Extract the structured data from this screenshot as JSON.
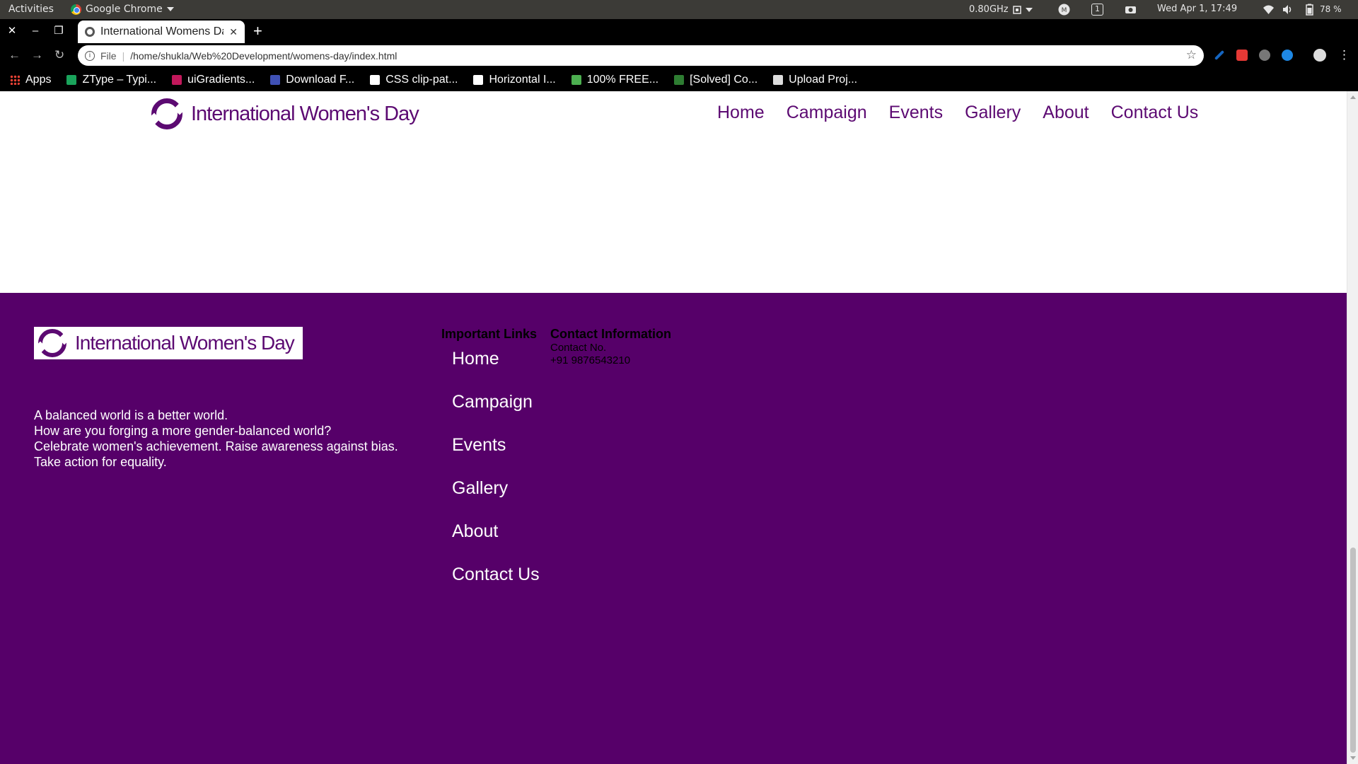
{
  "os_topbar": {
    "activities": "Activities",
    "app_name": "Google Chrome",
    "cpu": "0.80GHz",
    "workspace": "1",
    "datetime": "Wed Apr  1, 17:49",
    "battery": "78 %"
  },
  "browser": {
    "tab_title": "International Womens Day",
    "url_scheme_label": "File",
    "url": "/home/shukla/Web%20Development/womens-day/index.html",
    "bookmarks": [
      {
        "label": "Apps",
        "icon": "apps-grid-icon",
        "color": "#e94235"
      },
      {
        "label": "ZType – Typi...",
        "icon": "ztype-icon",
        "color": "#1aa35b"
      },
      {
        "label": "uiGradients...",
        "icon": "uigradients-icon",
        "color": "#c2185b"
      },
      {
        "label": "Download F...",
        "icon": "download-icon",
        "color": "#3f51b5"
      },
      {
        "label": "CSS clip-pat...",
        "icon": "codepen-icon",
        "color": "#ffffff"
      },
      {
        "label": "Horizontal I...",
        "icon": "codepen-icon",
        "color": "#ffffff"
      },
      {
        "label": "100% FREE...",
        "icon": "pen-icon",
        "color": "#4caf50"
      },
      {
        "label": "[Solved] Co...",
        "icon": "solved-icon",
        "color": "#2e7d32"
      },
      {
        "label": "Upload Proj...",
        "icon": "upload-icon",
        "color": "#dddddd"
      }
    ]
  },
  "site": {
    "logo_text": "International Women's Day",
    "brand_color": "#5c0a72",
    "footer_bg": "#560069",
    "nav": [
      "Home",
      "Campaign",
      "Events",
      "Gallery",
      "About",
      "Contact Us"
    ],
    "footer": {
      "tagline": [
        "A balanced world is a better world.",
        "How are you forging a more gender-balanced world?",
        "Celebrate women's achievement. Raise awareness against bias.",
        "Take action for equality."
      ],
      "links_heading": "Important Links",
      "links": [
        "Home",
        "Campaign",
        "Events",
        "Gallery",
        "About",
        "Contact Us"
      ],
      "contact_heading": "Contact Information",
      "contact_label": "Contact No.",
      "contact_number": "+91 9876543210"
    }
  }
}
